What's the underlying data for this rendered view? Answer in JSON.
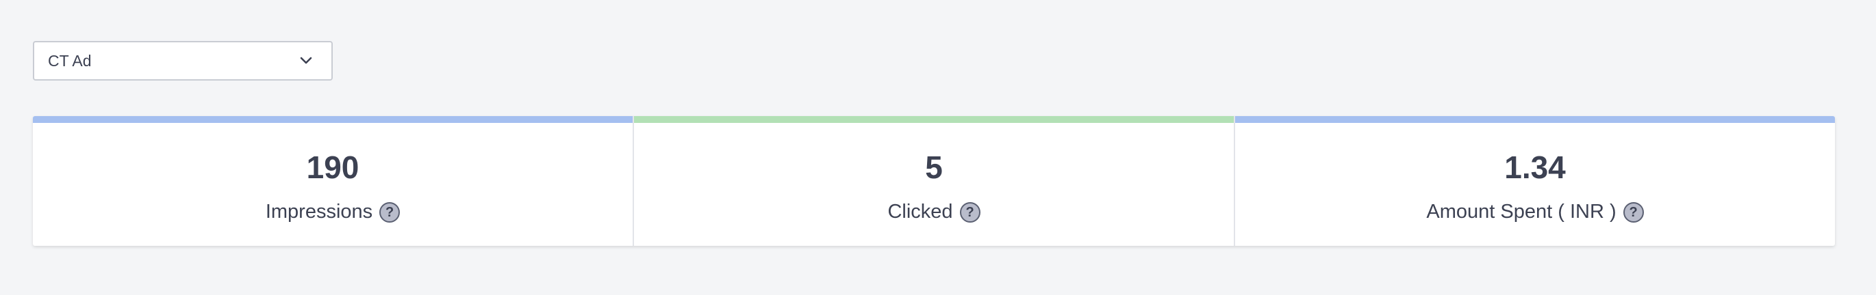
{
  "campaign_select": {
    "selected": "CT Ad"
  },
  "stats": [
    {
      "value": "190",
      "label": "Impressions",
      "help": "?",
      "accent_color": "#a4bff0"
    },
    {
      "value": "5",
      "label": "Clicked",
      "help": "?",
      "accent_color": "#b2e0b5"
    },
    {
      "value": "1.34",
      "label": "Amount Spent ( INR )",
      "help": "?",
      "accent_color": "#a4bff0"
    }
  ],
  "icons": {
    "dropdown": "chevron-down-icon",
    "help": "question-circle-icon"
  }
}
